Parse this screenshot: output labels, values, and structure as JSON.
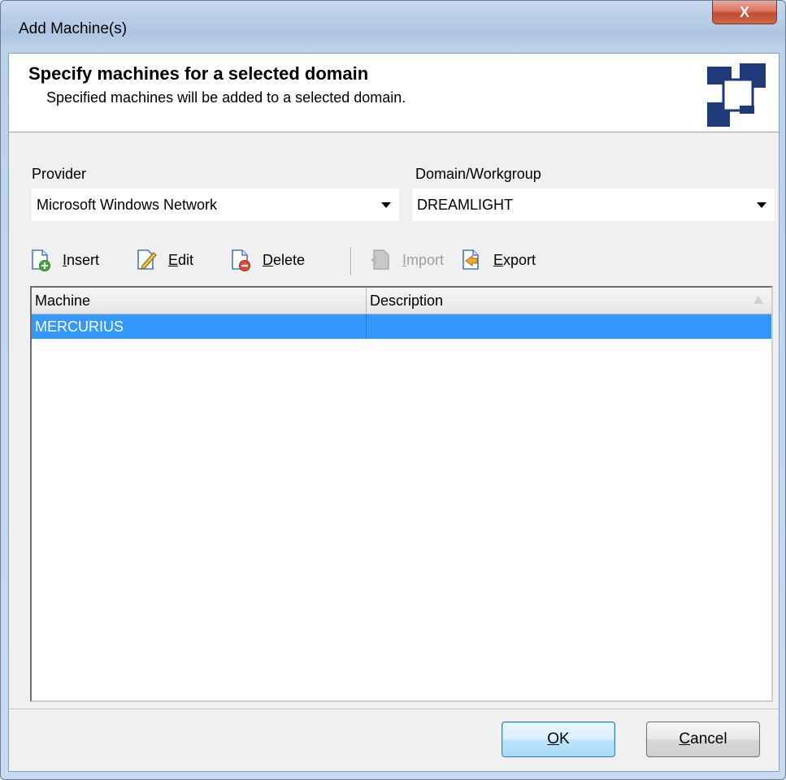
{
  "window": {
    "title": "Add Machine(s)",
    "close_label": "X"
  },
  "header": {
    "title": "Specify machines for a selected domain",
    "subtitle": "Specified machines will be added to a selected domain."
  },
  "form": {
    "provider_label": "Provider",
    "provider_value": "Microsoft Windows Network",
    "domain_label": "Domain/Workgroup",
    "domain_value": "DREAMLIGHT"
  },
  "toolbar": {
    "insert": {
      "pre": "",
      "key": "I",
      "post": "nsert",
      "icon": "insert-icon"
    },
    "edit": {
      "pre": "",
      "key": "E",
      "post": "dit",
      "icon": "edit-icon"
    },
    "delete": {
      "pre": "",
      "key": "D",
      "post": "elete",
      "icon": "delete-icon"
    },
    "import": {
      "pre": "",
      "key": "I",
      "post": "mport",
      "icon": "import-icon",
      "disabled": true
    },
    "export": {
      "pre": "",
      "key": "E",
      "post": "xport",
      "icon": "export-icon"
    }
  },
  "grid": {
    "columns": [
      "Machine",
      "Description"
    ],
    "rows": [
      {
        "machine": "MERCURIUS",
        "description": "",
        "selected": true
      }
    ]
  },
  "buttons": {
    "ok_key": "O",
    "ok_rest": "K",
    "cancel_key": "C",
    "cancel_rest": "ancel"
  },
  "colors": {
    "selection": "#3399ff",
    "logo_blue": "#1e3a78",
    "close": "#c24a2f"
  }
}
